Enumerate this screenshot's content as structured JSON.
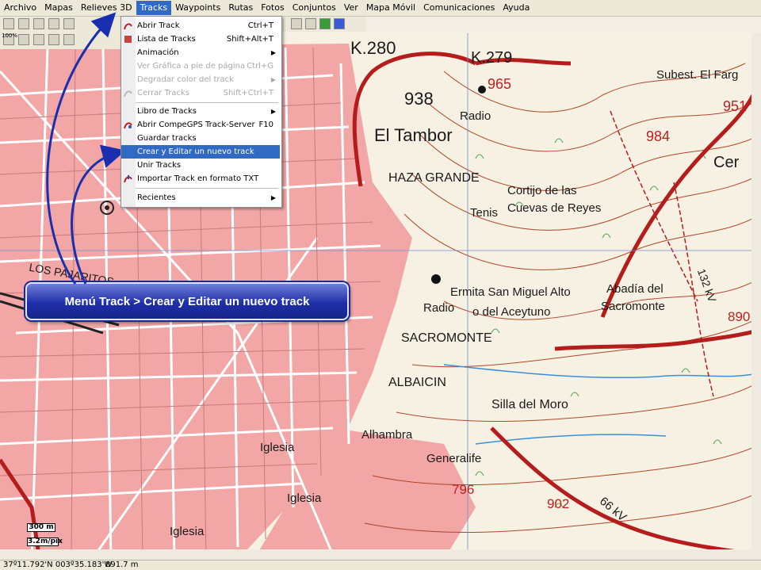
{
  "menubar": {
    "items": [
      "Archivo",
      "Mapas",
      "Relieves 3D",
      "Tracks",
      "Waypoints",
      "Rutas",
      "Fotos",
      "Conjuntos",
      "Ver",
      "Mapa Móvil",
      "Comunicaciones",
      "Ayuda"
    ]
  },
  "tracks_menu": {
    "items": [
      {
        "label": "Abrir Track",
        "shortcut": "Ctrl+T"
      },
      {
        "label": "Lista de Tracks",
        "shortcut": "Shift+Alt+T"
      },
      {
        "label": "Animación"
      },
      {
        "label": "Ver Gráfica a pie de página",
        "shortcut": "Ctrl+G"
      },
      {
        "label": "Degradar color del track"
      },
      {
        "label": "Cerrar Tracks",
        "shortcut": "Shift+Ctrl+T"
      },
      {
        "label": "Libro de Tracks"
      },
      {
        "label": "Abrir CompeGPS Track-Server",
        "shortcut": "F10"
      },
      {
        "label": "Guardar tracks"
      },
      {
        "label": "Crear y Editar un nuevo track"
      },
      {
        "label": "Unir Tracks"
      },
      {
        "label": "Importar Track en formato TXT"
      },
      {
        "label": "Recientes"
      }
    ]
  },
  "callout": {
    "text": "Menú Track > Crear y Editar un nuevo track"
  },
  "map_labels": {
    "k280": "K.280",
    "k279": "K.279",
    "n965": "965",
    "n938": "938",
    "radio1": "Radio",
    "eltambor": "El Tambor",
    "subest": "Subest. El Farg",
    "n951": "951",
    "n984": "984",
    "cer": "Cer",
    "hazagrande": "HAZA GRANDE",
    "cortijo": "Cortijo de las",
    "tenis": "Tenis",
    "cuevas": "Cuevas de Reyes",
    "lospajaritos": "LOS PAJARITOS",
    "ermita": "Ermita San Miguel Alto",
    "radio2": "Radio",
    "aceytuno": "o del Aceytuno",
    "abadia": "Abadía del",
    "sacromonte1": "Sacromonte",
    "sacromonte2": "SACROMONTE",
    "albaicin": "ALBAICIN",
    "sillamoro": "Silla del Moro",
    "alhambra": "Alhambra",
    "generalife": "Generalife",
    "iglesia1": "Iglesia",
    "iglesia2": "Iglesia",
    "iglesia3": "Iglesia",
    "n796": "796",
    "n902": "902",
    "kv66": "66 kV",
    "kv132": "132 kV",
    "n890": "890"
  },
  "scale": {
    "distance": "300 m",
    "resolution": "3.2m/pix",
    "zoom": "100%"
  },
  "status": {
    "coords": "37º11.792'N 003º35.183'W",
    "altitude": "891.7 m"
  },
  "colors": {
    "menu_highlight": "#316ac5",
    "urban": "#f0a0a0",
    "contour": "#b0452a",
    "callout": "#1f2fa8"
  }
}
